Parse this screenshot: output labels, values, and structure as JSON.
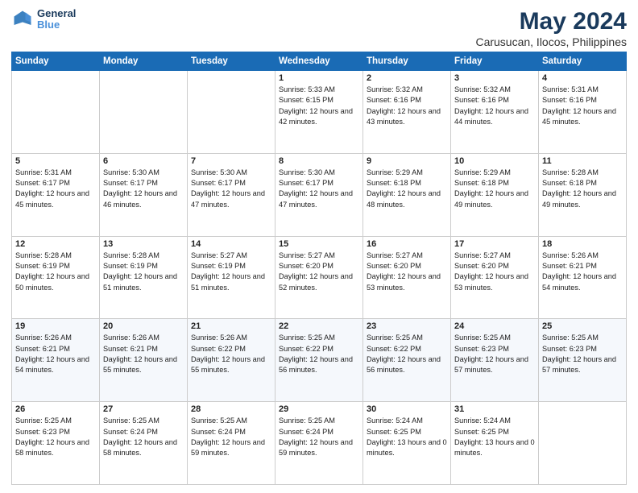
{
  "header": {
    "logo_line1": "General",
    "logo_line2": "Blue",
    "title": "May 2024",
    "subtitle": "Carusucan, Ilocos, Philippines"
  },
  "weekdays": [
    "Sunday",
    "Monday",
    "Tuesday",
    "Wednesday",
    "Thursday",
    "Friday",
    "Saturday"
  ],
  "weeks": [
    [
      {
        "day": "",
        "text": ""
      },
      {
        "day": "",
        "text": ""
      },
      {
        "day": "",
        "text": ""
      },
      {
        "day": "1",
        "text": "Sunrise: 5:33 AM\nSunset: 6:15 PM\nDaylight: 12 hours\nand 42 minutes."
      },
      {
        "day": "2",
        "text": "Sunrise: 5:32 AM\nSunset: 6:16 PM\nDaylight: 12 hours\nand 43 minutes."
      },
      {
        "day": "3",
        "text": "Sunrise: 5:32 AM\nSunset: 6:16 PM\nDaylight: 12 hours\nand 44 minutes."
      },
      {
        "day": "4",
        "text": "Sunrise: 5:31 AM\nSunset: 6:16 PM\nDaylight: 12 hours\nand 45 minutes."
      }
    ],
    [
      {
        "day": "5",
        "text": "Sunrise: 5:31 AM\nSunset: 6:17 PM\nDaylight: 12 hours\nand 45 minutes."
      },
      {
        "day": "6",
        "text": "Sunrise: 5:30 AM\nSunset: 6:17 PM\nDaylight: 12 hours\nand 46 minutes."
      },
      {
        "day": "7",
        "text": "Sunrise: 5:30 AM\nSunset: 6:17 PM\nDaylight: 12 hours\nand 47 minutes."
      },
      {
        "day": "8",
        "text": "Sunrise: 5:30 AM\nSunset: 6:17 PM\nDaylight: 12 hours\nand 47 minutes."
      },
      {
        "day": "9",
        "text": "Sunrise: 5:29 AM\nSunset: 6:18 PM\nDaylight: 12 hours\nand 48 minutes."
      },
      {
        "day": "10",
        "text": "Sunrise: 5:29 AM\nSunset: 6:18 PM\nDaylight: 12 hours\nand 49 minutes."
      },
      {
        "day": "11",
        "text": "Sunrise: 5:28 AM\nSunset: 6:18 PM\nDaylight: 12 hours\nand 49 minutes."
      }
    ],
    [
      {
        "day": "12",
        "text": "Sunrise: 5:28 AM\nSunset: 6:19 PM\nDaylight: 12 hours\nand 50 minutes."
      },
      {
        "day": "13",
        "text": "Sunrise: 5:28 AM\nSunset: 6:19 PM\nDaylight: 12 hours\nand 51 minutes."
      },
      {
        "day": "14",
        "text": "Sunrise: 5:27 AM\nSunset: 6:19 PM\nDaylight: 12 hours\nand 51 minutes."
      },
      {
        "day": "15",
        "text": "Sunrise: 5:27 AM\nSunset: 6:20 PM\nDaylight: 12 hours\nand 52 minutes."
      },
      {
        "day": "16",
        "text": "Sunrise: 5:27 AM\nSunset: 6:20 PM\nDaylight: 12 hours\nand 53 minutes."
      },
      {
        "day": "17",
        "text": "Sunrise: 5:27 AM\nSunset: 6:20 PM\nDaylight: 12 hours\nand 53 minutes."
      },
      {
        "day": "18",
        "text": "Sunrise: 5:26 AM\nSunset: 6:21 PM\nDaylight: 12 hours\nand 54 minutes."
      }
    ],
    [
      {
        "day": "19",
        "text": "Sunrise: 5:26 AM\nSunset: 6:21 PM\nDaylight: 12 hours\nand 54 minutes."
      },
      {
        "day": "20",
        "text": "Sunrise: 5:26 AM\nSunset: 6:21 PM\nDaylight: 12 hours\nand 55 minutes."
      },
      {
        "day": "21",
        "text": "Sunrise: 5:26 AM\nSunset: 6:22 PM\nDaylight: 12 hours\nand 55 minutes."
      },
      {
        "day": "22",
        "text": "Sunrise: 5:25 AM\nSunset: 6:22 PM\nDaylight: 12 hours\nand 56 minutes."
      },
      {
        "day": "23",
        "text": "Sunrise: 5:25 AM\nSunset: 6:22 PM\nDaylight: 12 hours\nand 56 minutes."
      },
      {
        "day": "24",
        "text": "Sunrise: 5:25 AM\nSunset: 6:23 PM\nDaylight: 12 hours\nand 57 minutes."
      },
      {
        "day": "25",
        "text": "Sunrise: 5:25 AM\nSunset: 6:23 PM\nDaylight: 12 hours\nand 57 minutes."
      }
    ],
    [
      {
        "day": "26",
        "text": "Sunrise: 5:25 AM\nSunset: 6:23 PM\nDaylight: 12 hours\nand 58 minutes."
      },
      {
        "day": "27",
        "text": "Sunrise: 5:25 AM\nSunset: 6:24 PM\nDaylight: 12 hours\nand 58 minutes."
      },
      {
        "day": "28",
        "text": "Sunrise: 5:25 AM\nSunset: 6:24 PM\nDaylight: 12 hours\nand 59 minutes."
      },
      {
        "day": "29",
        "text": "Sunrise: 5:25 AM\nSunset: 6:24 PM\nDaylight: 12 hours\nand 59 minutes."
      },
      {
        "day": "30",
        "text": "Sunrise: 5:24 AM\nSunset: 6:25 PM\nDaylight: 13 hours\nand 0 minutes."
      },
      {
        "day": "31",
        "text": "Sunrise: 5:24 AM\nSunset: 6:25 PM\nDaylight: 13 hours\nand 0 minutes."
      },
      {
        "day": "",
        "text": ""
      }
    ]
  ]
}
